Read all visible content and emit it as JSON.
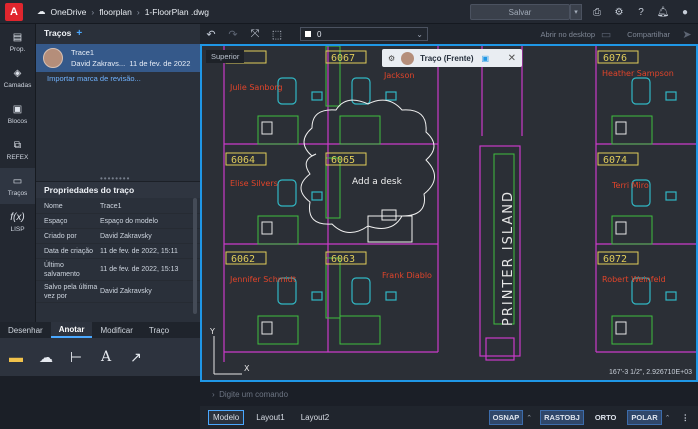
{
  "topbar": {
    "logo": "A",
    "crumbs": [
      "OneDrive",
      "floorplan",
      "1-FloorPlan .dwg"
    ],
    "save_label": "Salvar",
    "icons": [
      "printer-icon",
      "gear-icon",
      "help-icon",
      "bell-icon",
      "user-icon"
    ]
  },
  "rail": [
    {
      "label": "Prop.",
      "icon": "properties-icon"
    },
    {
      "label": "Camadas",
      "icon": "layers-icon"
    },
    {
      "label": "Blocos",
      "icon": "blocks-icon"
    },
    {
      "label": "REFEX",
      "icon": "xref-icon"
    },
    {
      "label": "Traços",
      "icon": "traces-icon"
    },
    {
      "label": "LISP",
      "icon": "function-icon"
    }
  ],
  "traces": {
    "title": "Traços",
    "item": {
      "name": "Trace1",
      "author": "David Zakravs...",
      "date": "11 de fev. de 2022"
    },
    "import_link": "Importar marca de revisão..."
  },
  "props": {
    "title": "Propriedades do traço",
    "rows": [
      {
        "k": "Nome",
        "v": "Trace1"
      },
      {
        "k": "Espaço",
        "v": "Espaço do modelo"
      },
      {
        "k": "Criado por",
        "v": "David Zakravsky"
      },
      {
        "k": "Data de criação",
        "v": "11 de fev. de 2022, 15:11"
      },
      {
        "k": "Último salvamento",
        "v": "11 de fev. de 2022, 15:13"
      },
      {
        "k": "Salvo pela última vez por",
        "v": "David Zakravsky"
      }
    ]
  },
  "bottom_tabs": [
    {
      "label": "Desenhar",
      "active": false
    },
    {
      "label": "Anotar",
      "active": true
    },
    {
      "label": "Modificar",
      "active": false
    },
    {
      "label": "Traço",
      "active": false
    }
  ],
  "canvas_toolbar": {
    "layer": "0",
    "open_desktop": "Abrir no desktop",
    "share": "Compartilhar"
  },
  "viewport": {
    "view_label": "Superior",
    "trace_name": "Traço (Frente)",
    "coords": "167'-3 1/2\", 2.926710E+03"
  },
  "drawing": {
    "rooms": [
      "6067",
      "6076",
      "6064",
      "6065",
      "6074",
      "6062",
      "6063",
      "6072"
    ],
    "names": [
      "Jackson",
      "Julie Sanborg",
      "Heather Sampson",
      "Elise Silvers",
      "Terri Miro",
      "Jennifer Schmidt",
      "Frank Diablo",
      "Robert Weinfeld"
    ],
    "cloud_note": "Add a desk",
    "island": "PRINTER ISLAND"
  },
  "command_placeholder": "Digite um comando",
  "status": {
    "tabs": [
      "Modelo",
      "Layout1",
      "Layout2"
    ],
    "buttons": [
      "OSNAP",
      "RASTOBJ",
      "ORTO",
      "POLAR"
    ]
  },
  "colors": {
    "accent": "#1f97e6",
    "cad_bg": "#2b2f36",
    "magenta": "#c93ac9",
    "green": "#3fbf3f",
    "cyan": "#31b7c4",
    "yellow": "#e0cc5a",
    "red": "#e0442a"
  }
}
